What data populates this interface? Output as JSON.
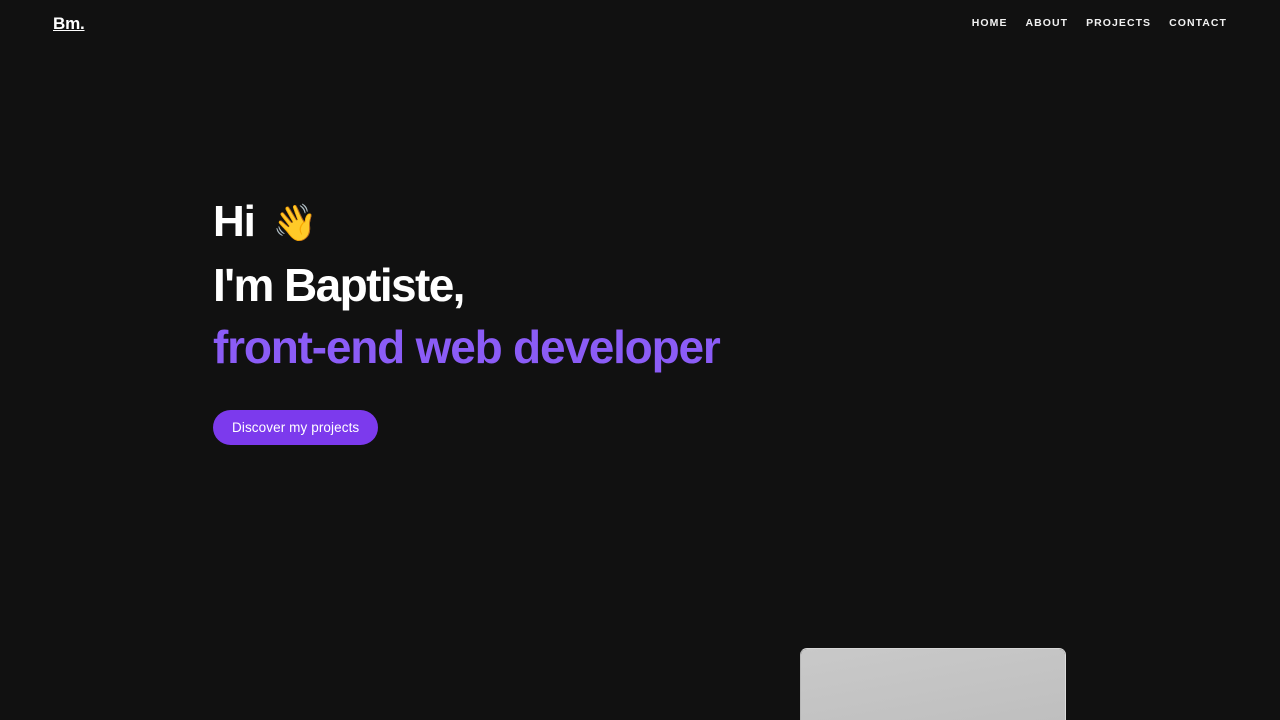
{
  "page": {
    "background_color": "#111111",
    "accent_color": "#8b5cf6",
    "button_color": "#7c3aed"
  },
  "header": {
    "logo": "Bm.",
    "nav": [
      {
        "label": "HOME"
      },
      {
        "label": "ABOUT"
      },
      {
        "label": "PROJECTS"
      },
      {
        "label": "CONTACT"
      }
    ]
  },
  "hero": {
    "greeting": "Hi",
    "wave_emoji": "👋",
    "name_line": "I'm Baptiste,",
    "role_line": "front-end web developer",
    "cta_label": "Discover my projects"
  },
  "mockup": {
    "label": "laptop-mockup"
  }
}
